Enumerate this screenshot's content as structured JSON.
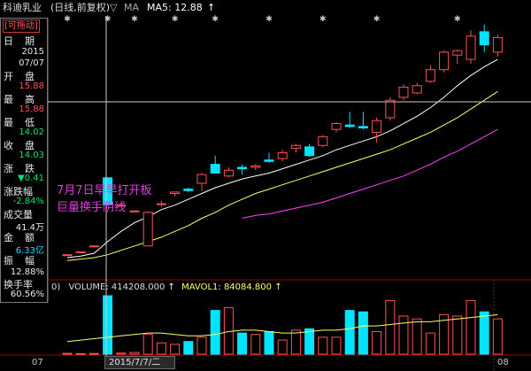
{
  "header": {
    "stock_name": "科迪乳业",
    "period": "(日线,前复权)",
    "ma_label": "MA5: 12.88",
    "ma_arrow": "↑"
  },
  "sidebar": {
    "badge": "[可拖动]",
    "date_label": "日　期",
    "date_year": "2015",
    "date_md": "07/07",
    "open_label": "开　盘",
    "open": "15.88",
    "high_label": "最　高",
    "high": "15.88",
    "low_label": "最　低",
    "low": "14.02",
    "close_label": "收　盘",
    "close": "14.03",
    "change_label": "涨　跌",
    "change": "▼0.41",
    "pct_label": "涨跌幅",
    "pct": "-2.84%",
    "volume_label": "成交量",
    "volume": "41.4万",
    "amount_label": "金　额",
    "amount": "6.33亿",
    "amplitude_label": "振　幅",
    "amplitude": "12.88%",
    "turnover_label": "换手率",
    "turnover": "60.56%"
  },
  "annotation": {
    "line1": "7月7日早早打开板",
    "line2": "巨量换手阴线"
  },
  "volume_panel": {
    "prefix": "0)",
    "volume_text": "VOLUME: 414208.000",
    "vol_arrow": "↑",
    "mavol_text": "MAVOL1: 84084.800",
    "mavol_arrow": "↑"
  },
  "x_axis": {
    "left_label": "07",
    "cursor_label": "2015/7/7/二",
    "right_label": "08"
  },
  "colors": {
    "up": "#ff5050",
    "down": "#00e5ff",
    "ma5": "#ffffff",
    "ma10": "#ffff66",
    "ma20": "#ff44ff",
    "annotation": "#e03ce0"
  },
  "chart_data": {
    "type": "candlestick",
    "candles": [
      {
        "o": 10.6,
        "h": 10.6,
        "l": 10.6,
        "c": 10.6
      },
      {
        "o": 10.8,
        "h": 10.8,
        "l": 10.8,
        "c": 10.8
      },
      {
        "o": 11.2,
        "h": 11.2,
        "l": 11.2,
        "c": 11.2
      },
      {
        "o": 15.88,
        "h": 15.88,
        "l": 14.02,
        "c": 14.03
      },
      {
        "o": 14.0,
        "h": 14.0,
        "l": 14.0,
        "c": 14.0
      },
      {
        "o": 13.6,
        "h": 13.6,
        "l": 13.6,
        "c": 13.6
      },
      {
        "o": 11.2,
        "h": 13.6,
        "l": 11.2,
        "c": 13.5
      },
      {
        "o": 14.1,
        "h": 14.3,
        "l": 13.9,
        "c": 14.1
      },
      {
        "o": 14.8,
        "h": 14.9,
        "l": 14.6,
        "c": 14.9
      },
      {
        "o": 15.1,
        "h": 15.2,
        "l": 14.9,
        "c": 15.0
      },
      {
        "o": 15.5,
        "h": 16.2,
        "l": 15.0,
        "c": 16.1
      },
      {
        "o": 16.8,
        "h": 17.4,
        "l": 16.2,
        "c": 16.2
      },
      {
        "o": 16.0,
        "h": 16.6,
        "l": 15.9,
        "c": 16.4
      },
      {
        "o": 16.6,
        "h": 16.8,
        "l": 16.1,
        "c": 16.5
      },
      {
        "o": 16.6,
        "h": 16.8,
        "l": 16.4,
        "c": 16.7
      },
      {
        "o": 17.1,
        "h": 17.6,
        "l": 16.9,
        "c": 17.0
      },
      {
        "o": 17.2,
        "h": 17.8,
        "l": 17.0,
        "c": 17.6
      },
      {
        "o": 17.9,
        "h": 18.2,
        "l": 17.6,
        "c": 18.1
      },
      {
        "o": 18.0,
        "h": 18.2,
        "l": 17.3,
        "c": 17.4
      },
      {
        "o": 18.1,
        "h": 18.8,
        "l": 18.0,
        "c": 18.7
      },
      {
        "o": 19.2,
        "h": 19.7,
        "l": 19.0,
        "c": 19.6
      },
      {
        "o": 19.5,
        "h": 20.4,
        "l": 19.3,
        "c": 19.4
      },
      {
        "o": 19.4,
        "h": 20.4,
        "l": 19.2,
        "c": 19.3
      },
      {
        "o": 19.0,
        "h": 20.0,
        "l": 18.3,
        "c": 19.8
      },
      {
        "o": 20.0,
        "h": 21.4,
        "l": 19.8,
        "c": 21.2
      },
      {
        "o": 21.4,
        "h": 22.3,
        "l": 21.2,
        "c": 22.1
      },
      {
        "o": 21.7,
        "h": 22.4,
        "l": 21.6,
        "c": 22.2
      },
      {
        "o": 22.5,
        "h": 23.6,
        "l": 22.4,
        "c": 23.3
      },
      {
        "o": 23.3,
        "h": 24.6,
        "l": 23.1,
        "c": 24.5
      },
      {
        "o": 24.3,
        "h": 24.7,
        "l": 23.7,
        "c": 24.6
      },
      {
        "o": 24.0,
        "h": 26.0,
        "l": 23.7,
        "c": 25.6
      },
      {
        "o": 25.9,
        "h": 26.4,
        "l": 24.5,
        "c": 25.0
      },
      {
        "o": 24.5,
        "h": 25.7,
        "l": 24.2,
        "c": 25.5
      }
    ],
    "volumes": [
      6000,
      4000,
      5000,
      414208,
      8000,
      12000,
      140000,
      80000,
      70000,
      90000,
      120000,
      310000,
      330000,
      150000,
      140000,
      160000,
      100000,
      170000,
      180000,
      120000,
      120000,
      310000,
      300000,
      160000,
      380000,
      270000,
      250000,
      150000,
      280000,
      270000,
      380000,
      300000,
      250000
    ],
    "ma5": [
      10.4,
      10.5,
      10.7,
      11.5,
      12.2,
      12.8,
      13.2,
      13.7,
      14.0,
      14.4,
      14.8,
      15.2,
      15.5,
      15.8,
      16.0,
      16.2,
      16.5,
      16.8,
      17.1,
      17.4,
      17.8,
      18.1,
      18.4,
      18.7,
      19.1,
      19.6,
      20.1,
      20.7,
      21.4,
      22.2,
      22.9,
      23.5,
      24.0
    ],
    "ma10": [
      10.2,
      10.3,
      10.4,
      10.6,
      10.9,
      11.2,
      11.5,
      11.8,
      12.2,
      12.6,
      13.1,
      13.5,
      14.0,
      14.4,
      14.8,
      15.1,
      15.4,
      15.7,
      16.0,
      16.3,
      16.6,
      16.9,
      17.2,
      17.5,
      17.8,
      18.2,
      18.6,
      19.0,
      19.5,
      20.0,
      20.6,
      21.2,
      21.8
    ],
    "ma20_start": 13,
    "ma20": [
      13.1,
      13.3,
      13.4,
      13.6,
      13.8,
      14.0,
      14.2,
      14.5,
      14.8,
      15.1,
      15.4,
      15.7,
      16.0,
      16.4,
      16.8,
      17.3,
      17.7,
      18.2,
      18.7,
      19.2
    ],
    "vol_ma": [
      90000,
      100000,
      110000,
      120000,
      130000,
      140000,
      150000,
      150000,
      140000,
      130000,
      130000,
      140000,
      160000,
      170000,
      170000,
      160000,
      150000,
      150000,
      160000,
      170000,
      170000,
      180000,
      200000,
      200000,
      210000,
      220000,
      230000,
      230000,
      240000,
      250000,
      260000,
      270000,
      280000
    ],
    "star_indices": [
      0,
      3,
      5,
      8,
      11,
      15,
      19,
      23,
      29
    ]
  }
}
